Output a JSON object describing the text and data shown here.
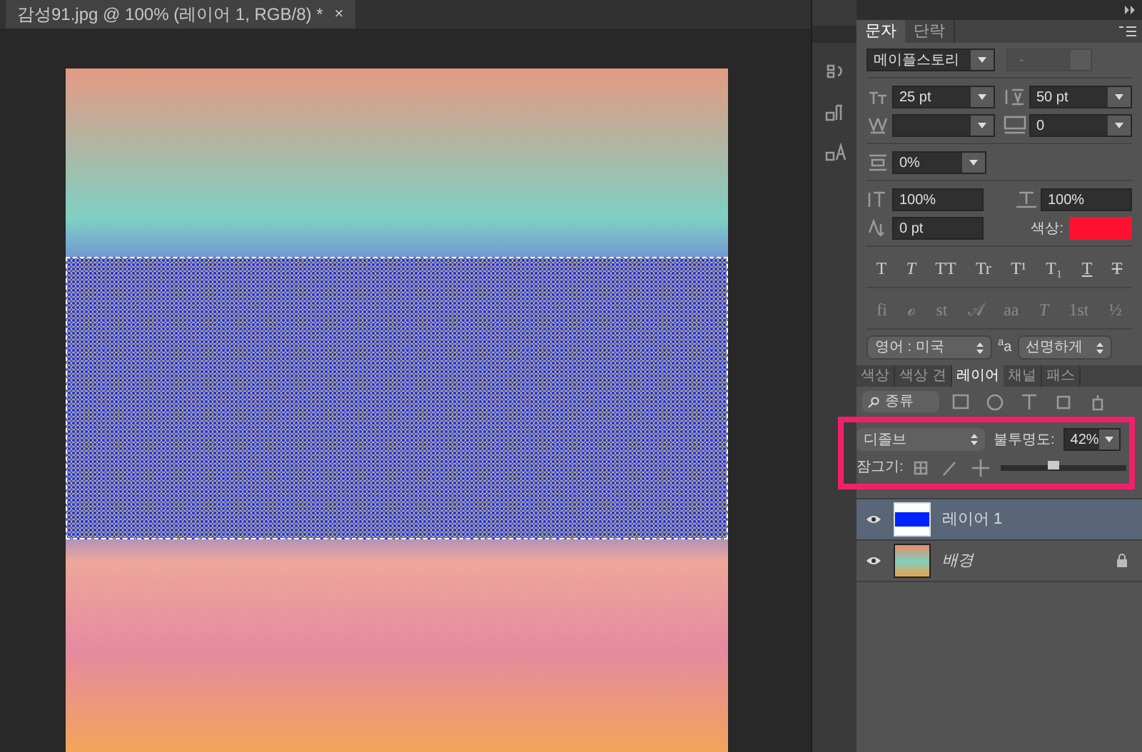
{
  "document_tab": {
    "title": "감성91.jpg @ 100% (레이어 1, RGB/8) *",
    "close": "×"
  },
  "character_panel": {
    "tabs": [
      {
        "label": "문자",
        "selected": true
      },
      {
        "label": "단락",
        "selected": false
      }
    ],
    "font_family": "메이플스토리",
    "font_style": "-",
    "font_size": "25 pt",
    "leading": "50 pt",
    "tracking": "0",
    "tsume": "0%",
    "vertical_scale": "100%",
    "horizontal_scale": "100%",
    "baseline_shift": "0 pt",
    "color_label": "색상:",
    "color": "#ff1030",
    "style_buttons": [
      "T",
      "T",
      "TT",
      "Tr",
      "T¹",
      "T₁",
      "T",
      "T"
    ],
    "opentype_buttons": [
      "fi",
      "ℴ",
      "st",
      "𝒜",
      "aa",
      "T",
      "1st",
      "½"
    ],
    "language": "영어 : 미국",
    "antialias_label": "$^{a}$a",
    "antialias": "선명하게"
  },
  "layers_panel": {
    "tabs": [
      {
        "label": "색상",
        "selected": false
      },
      {
        "label": "색상 견",
        "selected": false
      },
      {
        "label": "레이어",
        "selected": true
      },
      {
        "label": "채널",
        "selected": false
      },
      {
        "label": "패스",
        "selected": false
      }
    ],
    "filter": "종류",
    "blend_mode": "디졸브",
    "opacity_label": "불투명도:",
    "opacity": "42%",
    "opacity_slider": {
      "level": 0.42
    },
    "lock_label": "잠그기:",
    "layers": [
      {
        "name": "레이어 1",
        "kind": "layer",
        "selected": true,
        "visible": true,
        "locked": false
      },
      {
        "name": "배경",
        "kind": "background",
        "selected": false,
        "visible": true,
        "locked": true
      }
    ]
  }
}
